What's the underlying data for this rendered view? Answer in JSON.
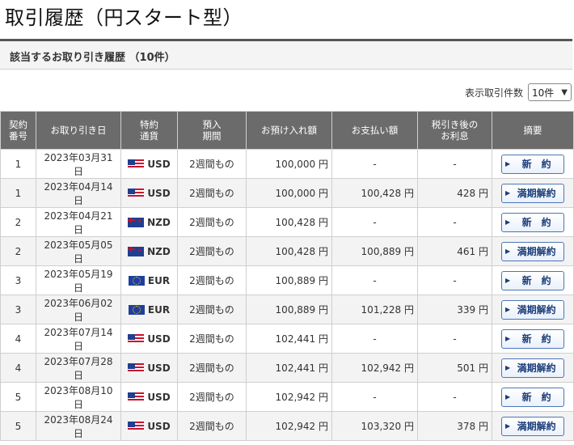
{
  "page": {
    "title": "取引履歴（円スタート型）",
    "section_title": "該当するお取り引き履歴 （10件）",
    "per_page_label": "表示取引件数",
    "per_page_value": "10件"
  },
  "table": {
    "headers": [
      "契約\n番号",
      "お取り引き日",
      "特約\n通貨",
      "預入\n期間",
      "お預け入れ額",
      "お支払い額",
      "税引き後の\nお利息",
      "摘要"
    ],
    "rows": [
      {
        "no": "1",
        "date": "2023年03月31日",
        "flag": "us",
        "currency": "USD",
        "period": "2週間もの",
        "deposit": "100,000 円",
        "payment": "-",
        "interest": "-",
        "action": "新　約"
      },
      {
        "no": "1",
        "date": "2023年04月14日",
        "flag": "us",
        "currency": "USD",
        "period": "2週間もの",
        "deposit": "100,000 円",
        "payment": "100,428 円",
        "interest": "428 円",
        "action": "満期解約"
      },
      {
        "no": "2",
        "date": "2023年04月21日",
        "flag": "nz",
        "currency": "NZD",
        "period": "2週間もの",
        "deposit": "100,428 円",
        "payment": "-",
        "interest": "-",
        "action": "新　約"
      },
      {
        "no": "2",
        "date": "2023年05月05日",
        "flag": "nz",
        "currency": "NZD",
        "period": "2週間もの",
        "deposit": "100,428 円",
        "payment": "100,889 円",
        "interest": "461 円",
        "action": "満期解約"
      },
      {
        "no": "3",
        "date": "2023年05月19日",
        "flag": "eu",
        "currency": "EUR",
        "period": "2週間もの",
        "deposit": "100,889 円",
        "payment": "-",
        "interest": "-",
        "action": "新　約"
      },
      {
        "no": "3",
        "date": "2023年06月02日",
        "flag": "eu",
        "currency": "EUR",
        "period": "2週間もの",
        "deposit": "100,889 円",
        "payment": "101,228 円",
        "interest": "339 円",
        "action": "満期解約"
      },
      {
        "no": "4",
        "date": "2023年07月14日",
        "flag": "us",
        "currency": "USD",
        "period": "2週間もの",
        "deposit": "102,441 円",
        "payment": "-",
        "interest": "-",
        "action": "新　約"
      },
      {
        "no": "4",
        "date": "2023年07月28日",
        "flag": "us",
        "currency": "USD",
        "period": "2週間もの",
        "deposit": "102,441 円",
        "payment": "102,942 円",
        "interest": "501 円",
        "action": "満期解約"
      },
      {
        "no": "5",
        "date": "2023年08月10日",
        "flag": "us",
        "currency": "USD",
        "period": "2週間もの",
        "deposit": "102,942 円",
        "payment": "-",
        "interest": "-",
        "action": "新　約"
      },
      {
        "no": "5",
        "date": "2023年08月24日",
        "flag": "us",
        "currency": "USD",
        "period": "2週間もの",
        "deposit": "102,942 円",
        "payment": "103,320 円",
        "interest": "378 円",
        "action": "満期解約"
      }
    ]
  },
  "colors": {
    "header_bg": "#6b6b6b",
    "button_border": "#4a76b8",
    "button_text": "#1b3d7a"
  }
}
